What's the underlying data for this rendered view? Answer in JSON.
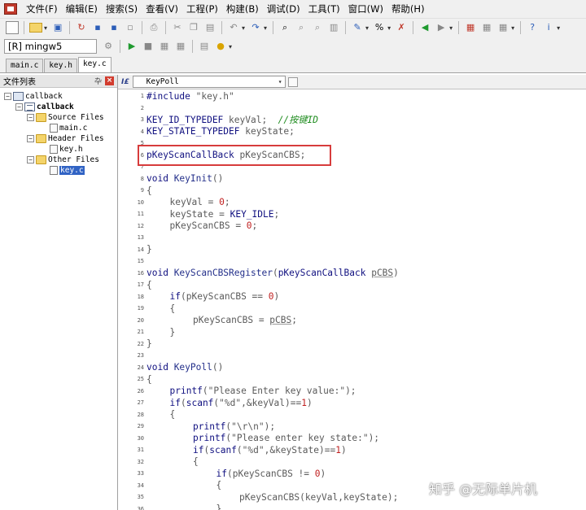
{
  "menubar": {
    "items": [
      "文件(F)",
      "编辑(E)",
      "搜索(S)",
      "查看(V)",
      "工程(P)",
      "构建(B)",
      "调试(D)",
      "工具(T)",
      "窗口(W)",
      "帮助(H)"
    ]
  },
  "toolbar2": {
    "compiler": "[R] mingw5"
  },
  "file_tabs": [
    "main.c",
    "key.h",
    "key.c"
  ],
  "project_panel": {
    "title": "文件列表",
    "tree": {
      "workspace": "callback",
      "project": "callback",
      "source_folder": "Source Files",
      "source_file": "main.c",
      "header_folder": "Header Files",
      "header_file": "key.h",
      "other_folder": "Other Files",
      "other_file": "key.c"
    }
  },
  "editor": {
    "function_selector": "KeyPoll",
    "lines": [
      {
        "n": "1",
        "indent": 0,
        "tokens": [
          {
            "c": "kw",
            "t": "#include "
          },
          {
            "c": "str",
            "t": "\"key.h\""
          }
        ]
      },
      {
        "n": "2",
        "indent": 0,
        "tokens": []
      },
      {
        "n": "3",
        "indent": 0,
        "tokens": [
          {
            "c": "kw",
            "t": "KEY_ID_TYPEDEF"
          },
          {
            "c": "plain",
            "t": " keyVal;  "
          },
          {
            "c": "cmt",
            "t": "//按键ID"
          }
        ]
      },
      {
        "n": "4",
        "indent": 0,
        "tokens": [
          {
            "c": "kw",
            "t": "KEY_STATE_TYPEDEF"
          },
          {
            "c": "plain",
            "t": " keyState;"
          }
        ]
      },
      {
        "n": "5",
        "indent": 0,
        "tokens": []
      },
      {
        "n": "6",
        "indent": 0,
        "tokens": [
          {
            "c": "kw",
            "t": "pKeyScanCallBack"
          },
          {
            "c": "plain",
            "t": " pKeyScanCBS;"
          }
        ]
      },
      {
        "n": "7",
        "indent": 0,
        "tokens": []
      },
      {
        "n": "8",
        "indent": 0,
        "tokens": [
          {
            "c": "kw",
            "t": "void "
          },
          {
            "c": "fn",
            "t": "KeyInit"
          },
          {
            "c": "plain",
            "t": "()"
          }
        ]
      },
      {
        "n": "9",
        "indent": 0,
        "tokens": [
          {
            "c": "plain",
            "t": "{"
          }
        ]
      },
      {
        "n": "10",
        "indent": 1,
        "tokens": [
          {
            "c": "plain",
            "t": "keyVal = "
          },
          {
            "c": "num",
            "t": "0"
          },
          {
            "c": "plain",
            "t": ";"
          }
        ]
      },
      {
        "n": "11",
        "indent": 1,
        "tokens": [
          {
            "c": "plain",
            "t": "keyState = "
          },
          {
            "c": "kw",
            "t": "KEY_IDLE"
          },
          {
            "c": "plain",
            "t": ";"
          }
        ]
      },
      {
        "n": "12",
        "indent": 1,
        "tokens": [
          {
            "c": "plain",
            "t": "pKeyScanCBS = "
          },
          {
            "c": "num",
            "t": "0"
          },
          {
            "c": "plain",
            "t": ";"
          }
        ]
      },
      {
        "n": "13",
        "indent": 0,
        "tokens": []
      },
      {
        "n": "14",
        "indent": 0,
        "tokens": [
          {
            "c": "plain",
            "t": "}"
          }
        ]
      },
      {
        "n": "15",
        "indent": 0,
        "tokens": []
      },
      {
        "n": "16",
        "indent": 0,
        "tokens": [
          {
            "c": "kw",
            "t": "void "
          },
          {
            "c": "fn",
            "t": "KeyScanCBSRegister"
          },
          {
            "c": "plain",
            "t": "("
          },
          {
            "c": "kw",
            "t": "pKeyScanCallBack "
          },
          {
            "c": "uline",
            "t": "pCBS"
          },
          {
            "c": "plain",
            "t": ")"
          }
        ]
      },
      {
        "n": "17",
        "indent": 0,
        "tokens": [
          {
            "c": "plain",
            "t": "{"
          }
        ]
      },
      {
        "n": "18",
        "indent": 1,
        "tokens": [
          {
            "c": "kw",
            "t": "if"
          },
          {
            "c": "plain",
            "t": "(pKeyScanCBS == "
          },
          {
            "c": "num",
            "t": "0"
          },
          {
            "c": "plain",
            "t": ")"
          }
        ]
      },
      {
        "n": "19",
        "indent": 1,
        "tokens": [
          {
            "c": "plain",
            "t": "{"
          }
        ]
      },
      {
        "n": "20",
        "indent": 2,
        "tokens": [
          {
            "c": "plain",
            "t": "pKeyScanCBS = "
          },
          {
            "c": "uline",
            "t": "pCBS"
          },
          {
            "c": "plain",
            "t": ";"
          }
        ]
      },
      {
        "n": "21",
        "indent": 1,
        "tokens": [
          {
            "c": "plain",
            "t": "}"
          }
        ]
      },
      {
        "n": "22",
        "indent": 0,
        "tokens": [
          {
            "c": "plain",
            "t": "}"
          }
        ]
      },
      {
        "n": "23",
        "indent": 0,
        "tokens": []
      },
      {
        "n": "24",
        "indent": 0,
        "tokens": [
          {
            "c": "kw",
            "t": "void "
          },
          {
            "c": "fn",
            "t": "KeyPoll"
          },
          {
            "c": "plain",
            "t": "()"
          }
        ]
      },
      {
        "n": "25",
        "indent": 0,
        "tokens": [
          {
            "c": "plain",
            "t": "{"
          }
        ]
      },
      {
        "n": "26",
        "indent": 1,
        "tokens": [
          {
            "c": "kw",
            "t": "printf"
          },
          {
            "c": "plain",
            "t": "("
          },
          {
            "c": "str",
            "t": "\"Please Enter key value:\""
          },
          {
            "c": "plain",
            "t": ");"
          }
        ]
      },
      {
        "n": "27",
        "indent": 1,
        "tokens": [
          {
            "c": "kw",
            "t": "if"
          },
          {
            "c": "plain",
            "t": "("
          },
          {
            "c": "kw",
            "t": "scanf"
          },
          {
            "c": "plain",
            "t": "("
          },
          {
            "c": "str",
            "t": "\"%d\""
          },
          {
            "c": "plain",
            "t": ",&keyVal)=="
          },
          {
            "c": "num",
            "t": "1"
          },
          {
            "c": "plain",
            "t": ")"
          }
        ]
      },
      {
        "n": "28",
        "indent": 1,
        "tokens": [
          {
            "c": "plain",
            "t": "{"
          }
        ]
      },
      {
        "n": "29",
        "indent": 2,
        "tokens": [
          {
            "c": "kw",
            "t": "printf"
          },
          {
            "c": "plain",
            "t": "("
          },
          {
            "c": "str",
            "t": "\"\\r\\n\""
          },
          {
            "c": "plain",
            "t": ");"
          }
        ]
      },
      {
        "n": "30",
        "indent": 2,
        "tokens": [
          {
            "c": "kw",
            "t": "printf"
          },
          {
            "c": "plain",
            "t": "("
          },
          {
            "c": "str",
            "t": "\"Please enter key state:\""
          },
          {
            "c": "plain",
            "t": ");"
          }
        ]
      },
      {
        "n": "31",
        "indent": 2,
        "tokens": [
          {
            "c": "kw",
            "t": "if"
          },
          {
            "c": "plain",
            "t": "("
          },
          {
            "c": "kw",
            "t": "scanf"
          },
          {
            "c": "plain",
            "t": "("
          },
          {
            "c": "str",
            "t": "\"%d\""
          },
          {
            "c": "plain",
            "t": ",&keyState)=="
          },
          {
            "c": "num",
            "t": "1"
          },
          {
            "c": "plain",
            "t": ")"
          }
        ]
      },
      {
        "n": "32",
        "indent": 2,
        "tokens": [
          {
            "c": "plain",
            "t": "{"
          }
        ]
      },
      {
        "n": "33",
        "indent": 3,
        "tokens": [
          {
            "c": "kw",
            "t": "if"
          },
          {
            "c": "plain",
            "t": "(pKeyScanCBS != "
          },
          {
            "c": "num",
            "t": "0"
          },
          {
            "c": "plain",
            "t": ")"
          }
        ]
      },
      {
        "n": "34",
        "indent": 3,
        "tokens": [
          {
            "c": "plain",
            "t": "{"
          }
        ]
      },
      {
        "n": "35",
        "indent": 4,
        "tokens": [
          {
            "c": "plain",
            "t": "pKeyScanCBS(keyVal,keyState);"
          }
        ]
      },
      {
        "n": "36",
        "indent": 3,
        "tokens": [
          {
            "c": "plain",
            "t": "}"
          }
        ]
      }
    ]
  },
  "watermark": "知乎 @无际单片机",
  "colors": {
    "keyword": "#101080",
    "comment": "#1e8c1e",
    "number": "#c02020",
    "highlight_box": "#d73c3c",
    "selection": "#3163c4"
  }
}
